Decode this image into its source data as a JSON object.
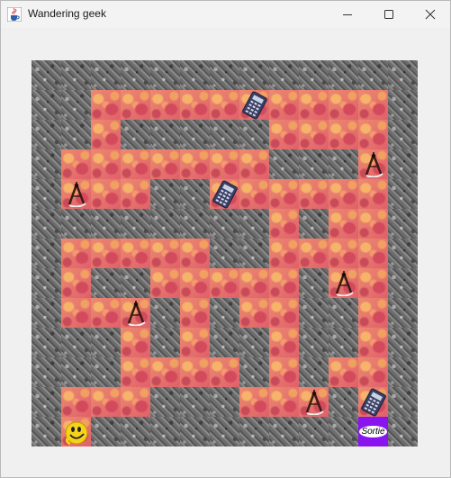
{
  "window": {
    "title": "Wandering geek",
    "minimize_icon": "minimize-icon",
    "maximize_icon": "maximize-icon",
    "close_icon": "close-icon",
    "app_icon": "java-cup-icon"
  },
  "maze": {
    "rows": 13,
    "cols": 13,
    "legend": {
      "W": "wall",
      "P": "path",
      "C": "calculator",
      "D": "compass",
      "S": "player-smiley",
      "E": "exit"
    },
    "grid": [
      "WWWWWWWWWWWWW",
      "WWPPPPPCPPPPW",
      "WWPWWWWWPPPPW",
      "WPPPPPPPWWWDW",
      "WDPPWWCPPPPPW",
      "WWWWWWWWPWPPW",
      "WPPPPPWWPPPPW",
      "WPWWPPPPPWDPW",
      "WPPDWPWPPWWPW",
      "WWWPWPWWPWWPW",
      "WWWPPPPWPWPPW",
      "WPPPWWWPPDWCW",
      "WSWWWWWWWWWEW"
    ],
    "exit_label": "Sortie",
    "colors": {
      "exit": "#8a14f0",
      "path": "#e8766a",
      "wall": "#777777"
    }
  }
}
